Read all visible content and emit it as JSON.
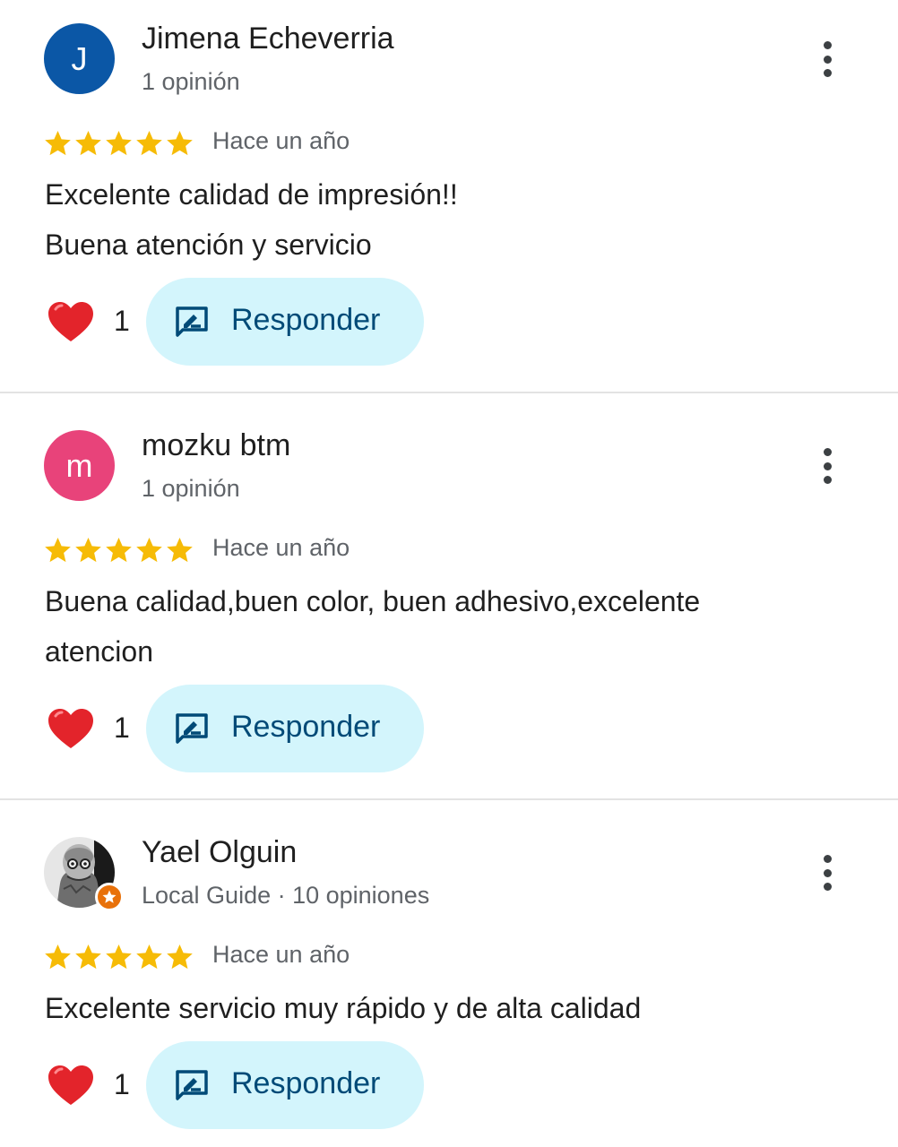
{
  "colors": {
    "star": "#f6bb06",
    "heart": "#e3242b",
    "reply_bg": "#d3f5fc",
    "reply_text": "#004a77",
    "secondary_text": "#5f6368",
    "divider": "#e3e3e3"
  },
  "reviews": [
    {
      "avatar_letter": "J",
      "avatar_color": "#0b57a6",
      "name": "Jimena Echeverria",
      "meta": "1 opinión",
      "rating": 5,
      "date": "Hace un año",
      "text_lines": [
        "Excelente calidad de impresión!!",
        "Buena atención y servicio"
      ],
      "like_icon": "heart-icon",
      "likes": "1",
      "reply_icon": "rate-review-icon",
      "reply_label": "Responder",
      "menu_icon": "more-vert-icon"
    },
    {
      "avatar_letter": "m",
      "avatar_color": "#e8437a",
      "name": "mozku btm",
      "meta": "1 opinión",
      "rating": 5,
      "date": "Hace un año",
      "text_lines": [
        "Buena calidad,buen color, buen adhesivo,excelente",
        "atencion"
      ],
      "like_icon": "heart-icon",
      "likes": "1",
      "reply_icon": "rate-review-icon",
      "reply_label": "Responder",
      "menu_icon": "more-vert-icon"
    },
    {
      "avatar_letter": "",
      "avatar_color": "#d9d9d9",
      "badge_icon": "local-guide-star-icon",
      "name": "Yael Olguin",
      "meta": "Local Guide · 10 opiniones",
      "rating": 5,
      "date": "Hace un año",
      "text_lines": [
        "Excelente servicio muy rápido y de alta calidad"
      ],
      "like_icon": "heart-icon",
      "likes": "1",
      "reply_icon": "rate-review-icon",
      "reply_label": "Responder",
      "menu_icon": "more-vert-icon"
    }
  ]
}
